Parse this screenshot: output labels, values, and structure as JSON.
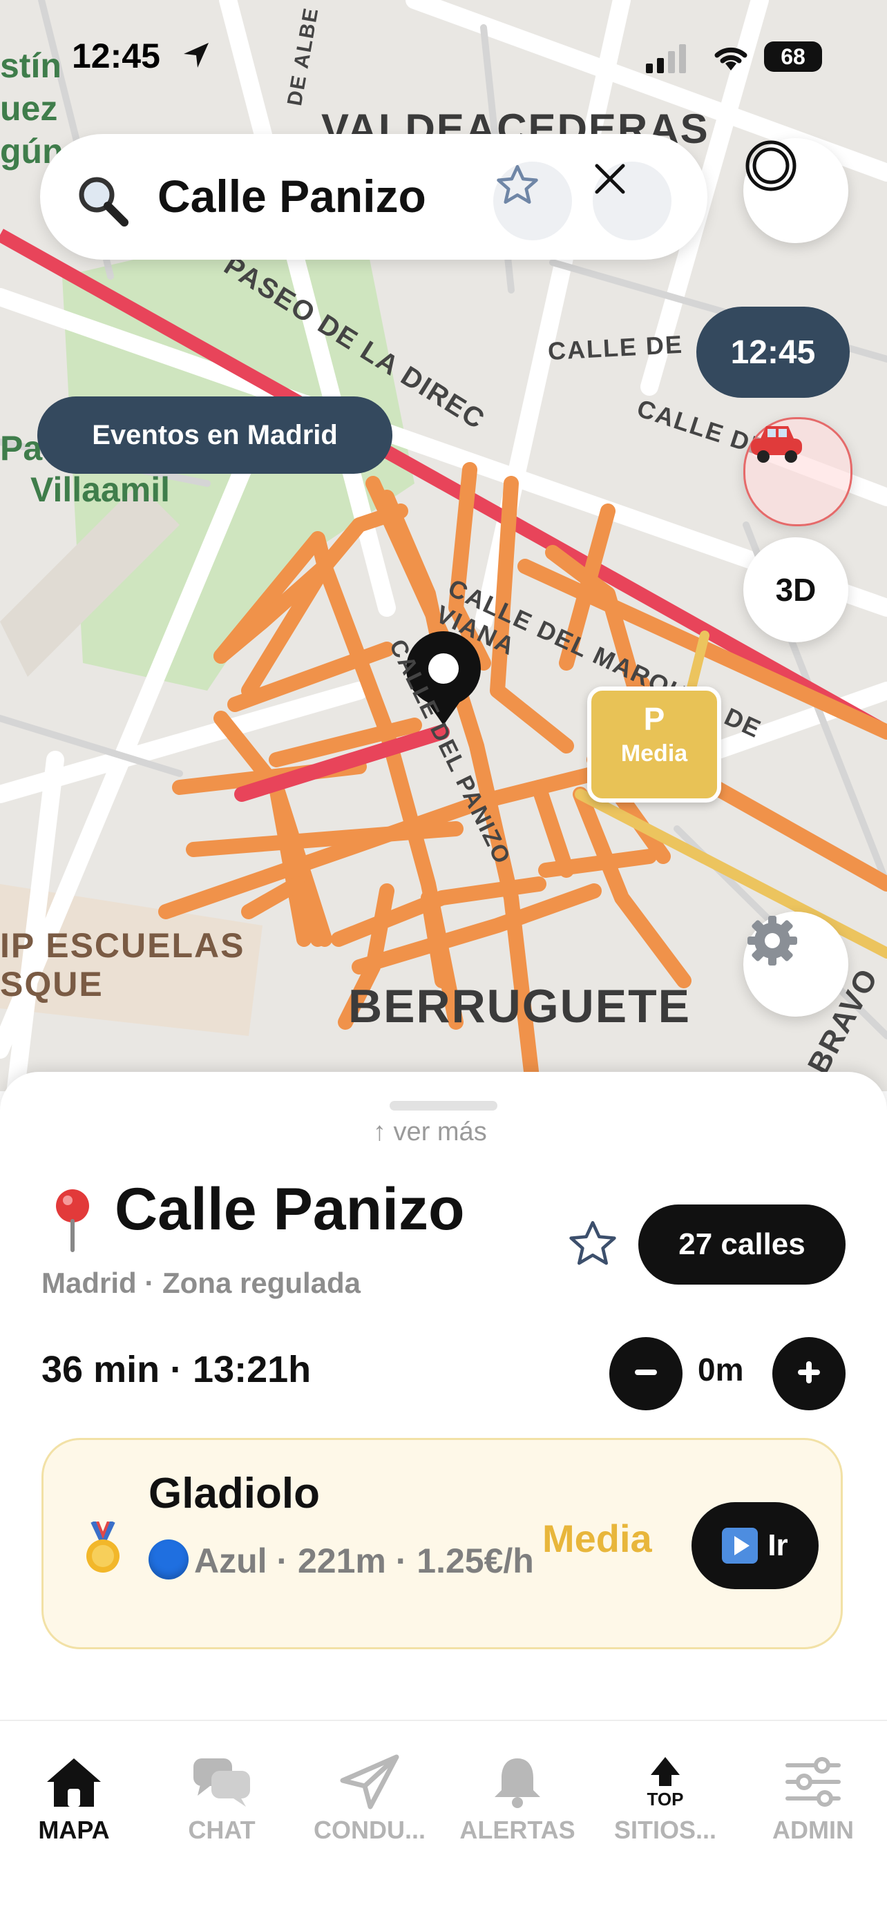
{
  "status_bar": {
    "time": "12:45",
    "battery": "68"
  },
  "map": {
    "area_labels": [
      "VALDEACEDERAS",
      "BERRUGUETE",
      "IP ESCUELAS",
      "SQUE",
      "Villaamil",
      "Pa",
      "stín",
      "uez",
      "gún"
    ],
    "street_labels": [
      "CALLE DEL MARQUÉS DE VIANA",
      "CALLE DEL PANIZO",
      "CALLE DE",
      "CALLE DE",
      "PASEO DE LA DIREC",
      "BRAVO",
      "DE ALBE"
    ]
  },
  "search": {
    "query": "Calle Panizo"
  },
  "controls": {
    "clock": "12:45",
    "events_label": "Eventos en Madrid",
    "view_3d": "3D"
  },
  "parking_marker": {
    "letter": "P",
    "level": "Media"
  },
  "sheet": {
    "more_label": "↑ ver más",
    "title": "Calle Panizo",
    "subtitle": "Madrid · Zona regulada",
    "streets_count": "27 calles",
    "eta": "36 min · 13:21h",
    "distance": "0m",
    "suggestion": {
      "street": "Gladiolo",
      "details": "Azul · 221m · 1.25€/h",
      "level": "Media",
      "go_label": "Ir"
    }
  },
  "tabs": [
    {
      "label": "MAPA",
      "icon": "home-icon",
      "active": true
    },
    {
      "label": "CHAT",
      "icon": "chat-icon",
      "active": false
    },
    {
      "label": "CONDU...",
      "icon": "send-icon",
      "active": false
    },
    {
      "label": "ALERTAS",
      "icon": "bell-icon",
      "active": false
    },
    {
      "label": "SITIOS...",
      "icon": "top-icon",
      "active": false
    },
    {
      "label": "ADMIN",
      "icon": "sliders-icon",
      "active": false
    }
  ],
  "tab_top_label": "TOP",
  "colors": {
    "accent_dark": "#34495e",
    "route_orange": "#f0924a",
    "route_red": "#e8445a",
    "level_yellow": "#e8b63b"
  }
}
